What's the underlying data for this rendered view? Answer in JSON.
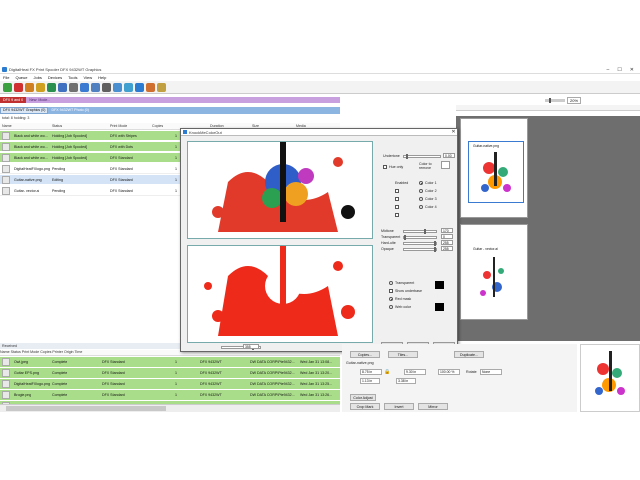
{
  "window": {
    "title": "DigitalHeat FX Print Spooler DFX 9432WT Graphics",
    "controls": [
      "–",
      "☐",
      "✕"
    ]
  },
  "menu": [
    "File",
    "Queue",
    "Jobs",
    "Devices",
    "Tools",
    "View",
    "Help"
  ],
  "toolbar": {
    "buttons": [
      {
        "name": "add-job",
        "color": "#3aa040"
      },
      {
        "name": "remove-job",
        "color": "#d03030"
      },
      {
        "name": "print",
        "color": "#d08020"
      },
      {
        "name": "hold",
        "color": "#d0a020"
      },
      {
        "name": "refresh",
        "color": "#2a9050"
      },
      {
        "name": "ripped",
        "color": "#4070c0"
      },
      {
        "name": "settings",
        "color": "#707070"
      },
      {
        "name": "layout",
        "color": "#3a7ad0"
      },
      {
        "name": "arrange",
        "color": "#5080c0"
      },
      {
        "name": "cut",
        "color": "#606060"
      },
      {
        "name": "copy",
        "color": "#4a90d0"
      },
      {
        "name": "mirror",
        "color": "#40a0d0"
      },
      {
        "name": "rotate",
        "color": "#2b7bd0"
      },
      {
        "name": "color",
        "color": "#d07030"
      },
      {
        "name": "palette",
        "color": "#c0a040"
      }
    ]
  },
  "zoom": {
    "value": "20%"
  },
  "queue": {
    "tab_main": "DFX 9 and 0",
    "tab_second": "New: Mode..."
  },
  "printer": {
    "tab_main": "DFX 9432WT Graphics (0)",
    "tab_second": "DFX 9432WT Photo (0)"
  },
  "totals": "total: 8   holding: 3",
  "jobs_table": {
    "headers": [
      "Name",
      "Status",
      "Print Mode",
      "Copies",
      "Duration",
      "Size",
      "Media"
    ],
    "rows": [
      {
        "name": "Black and white wo...",
        "status": "Holding [Job Spooled]",
        "mode": "DFX with Stripes",
        "copies": "1",
        "style": "green"
      },
      {
        "name": "Black and white wo...",
        "status": "Holding [Job Spooled]",
        "mode": "DFX with Dots",
        "copies": "1",
        "style": "green"
      },
      {
        "name": "Black and white wo...",
        "status": "Holding [Job Spooled]",
        "mode": "DFX Standard",
        "copies": "1",
        "style": "green"
      },
      {
        "name": "DigitalHeatFXlogo.png",
        "status": "Pending",
        "mode": "DFX Standard",
        "copies": "1",
        "style": "white"
      },
      {
        "name": "Guitar-native.png",
        "status": "Editing",
        "mode": "DFX Standard",
        "copies": "1",
        "style": "sel"
      },
      {
        "name": "Guitar- vector.ai",
        "status": "Pending",
        "mode": "DFX Standard",
        "copies": "1",
        "style": "white"
      }
    ]
  },
  "received": {
    "label": "Received",
    "headers": [
      "Name",
      "Status",
      "Print Mode",
      "Copies",
      "Printer",
      "Origin",
      "Time"
    ],
    "rows": [
      {
        "name": "Owl.jpeg",
        "status": "Complete",
        "mode": "DFX Standard",
        "copies": "1",
        "printer": "DFX 9432WT",
        "origin": "DW DATA CORP\\Pte9432...",
        "time": "Wed Jan 31 13:08..."
      },
      {
        "name": "Guitar EPS.png",
        "status": "Complete",
        "mode": "DFX Standard",
        "copies": "1",
        "printer": "DFX 9432WT",
        "origin": "DW DATA CORP\\Pte9432...",
        "time": "Wed Jan 31 13:20..."
      },
      {
        "name": "DigitalHeatFXlogo.png",
        "status": "Complete",
        "mode": "DFX Standard",
        "copies": "1",
        "printer": "DFX 9432WT",
        "origin": "DW DATA CORP\\Pte9432...",
        "time": "Wed Jan 31 13:25..."
      },
      {
        "name": "Brogie.png",
        "status": "Complete",
        "mode": "DFX Standard",
        "copies": "1",
        "printer": "DFX 9432WT",
        "origin": "DW DATA CORP\\Pte9432...",
        "time": "Wed Jan 31 13:26..."
      },
      {
        "name": "dragon.pdf",
        "status": "Complete",
        "mode": "DFX Standard",
        "copies": "1",
        "printer": "DFX 9432WT",
        "origin": "DW DATA CORP\\Pte9432...",
        "time": "Wed Jan 31 13:38..."
      }
    ]
  },
  "dialog": {
    "title": "KnockMeColorOut",
    "undertone_label": "Undertone",
    "undertone_value": "0.00",
    "hue_only_label": "Hue only",
    "color_to_remove_label": "Color to remove",
    "enabled_label": "Enabled",
    "colors": [
      "Color 1",
      "Color 2",
      "Color 3",
      "Color 4"
    ],
    "sliders": [
      {
        "label": "Midtone",
        "value": "170"
      },
      {
        "label": "Transparent",
        "value": "0"
      },
      {
        "label": "Hard-ulte",
        "value": "255"
      },
      {
        "label": "Opaque",
        "value": "255"
      }
    ],
    "options": [
      {
        "label": "Transparent",
        "type": "radio",
        "on": false
      },
      {
        "label": "Show underbase",
        "type": "check",
        "on": false
      },
      {
        "label": "Red mask",
        "type": "radio",
        "on": true
      },
      {
        "label": "Web color",
        "type": "radio",
        "on": false
      }
    ],
    "zoom_value": "355",
    "buttons": {
      "reset": "Reset",
      "ok": "OK",
      "cancel": "Cancel"
    }
  },
  "canvas": {
    "page1_label": "Guitar-native.png",
    "page2_label": "Guitar - vector.ai"
  },
  "job_panel": {
    "copies_btn": "Copies...",
    "tiles_btn": "Tiles...",
    "duplicate_btn": "Duplicate...",
    "filename": "Guitar-native.png",
    "width": "8.75 in",
    "height": "9.30 in",
    "scale": "100.00 %",
    "rotate_label": "Rotate",
    "rotate_value": "None",
    "x": "1.13 in",
    "y": "3.38 in",
    "color_adjust_btn": "Color Adjust",
    "crop_mark_btn": "Crop Mark",
    "invert_btn": "Invert",
    "mirror_btn": "Mirror"
  }
}
